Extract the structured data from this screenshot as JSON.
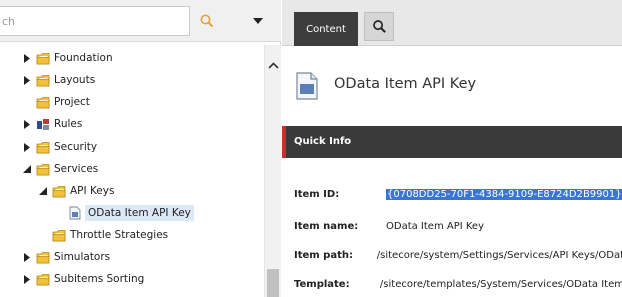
{
  "search": {
    "value": "ch",
    "placeholder": ""
  },
  "tree": {
    "items": [
      {
        "label": "Foundation",
        "icon": "folder-icon",
        "expander": "collapsed"
      },
      {
        "label": "Layouts",
        "icon": "folder-icon",
        "expander": "collapsed"
      },
      {
        "label": "Project",
        "icon": "folder-icon",
        "expander": "none"
      },
      {
        "label": "Rules",
        "icon": "rules-icon",
        "expander": "collapsed"
      },
      {
        "label": "Security",
        "icon": "folder-icon",
        "expander": "collapsed"
      },
      {
        "label": "Services",
        "icon": "folder-icon",
        "expander": "expanded"
      },
      {
        "label": "API Keys",
        "icon": "folder-icon",
        "expander": "expanded"
      },
      {
        "label": "OData Item API Key",
        "icon": "document-icon",
        "expander": "none",
        "selected": true
      },
      {
        "label": "Throttle Strategies",
        "icon": "folder-icon",
        "expander": "none"
      },
      {
        "label": "Simulators",
        "icon": "folder-icon",
        "expander": "collapsed"
      },
      {
        "label": "Subitems Sorting",
        "icon": "folder-icon",
        "expander": "collapsed"
      }
    ]
  },
  "tabs": {
    "content_label": "Content"
  },
  "item": {
    "title": "OData Item API Key"
  },
  "quick_info": {
    "label": "Quick Info",
    "rows": [
      {
        "key": "Item ID:",
        "value": "{0708DD25-70F1-4384-9109-E8724D2B9901}",
        "highlight": true
      },
      {
        "key": "Item name:",
        "value": "OData Item API Key"
      },
      {
        "key": "Item path:",
        "value": "/sitecore/system/Settings/Services/API Keys/ODat"
      },
      {
        "key": "Template:",
        "value": "/sitecore/templates/System/Services/OData Item"
      }
    ]
  },
  "colors": {
    "accent_red": "#c9302c",
    "dark_bar": "#3a3a3a",
    "selection_blue": "#3875d7",
    "folder_yellow": "#f2c13a"
  }
}
